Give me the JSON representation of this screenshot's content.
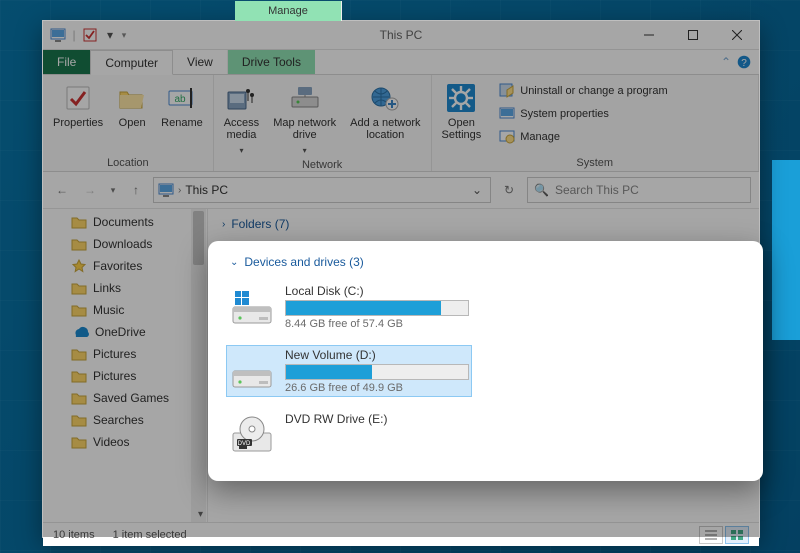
{
  "title": "This PC",
  "context_caption": "Manage",
  "tabs": {
    "file": "File",
    "computer": "Computer",
    "view": "View",
    "drivetools": "Drive Tools"
  },
  "ribbon": {
    "location": {
      "properties": "Properties",
      "open": "Open",
      "rename": "Rename",
      "caption": "Location"
    },
    "network": {
      "access": "Access\nmedia",
      "map": "Map network\ndrive",
      "add": "Add a network\nlocation",
      "caption": "Network"
    },
    "system": {
      "open": "Open\nSettings",
      "uninstall": "Uninstall or change a program",
      "sysprops": "System properties",
      "manage": "Manage",
      "caption": "System"
    }
  },
  "breadcrumb": "This PC",
  "search_placeholder": "Search This PC",
  "nav_items": [
    "Documents",
    "Downloads",
    "Favorites",
    "Links",
    "Music",
    "OneDrive",
    "Pictures",
    "Pictures",
    "Saved Games",
    "Searches",
    "Videos"
  ],
  "folders_header": "Folders (7)",
  "devices_header": "Devices and drives (3)",
  "drives": [
    {
      "name": "Local Disk (C:)",
      "free": "8.44 GB free of 57.4 GB",
      "fill_pct": 85,
      "type": "hdd-win",
      "selected": false
    },
    {
      "name": "New Volume (D:)",
      "free": "26.6 GB free of 49.9 GB",
      "fill_pct": 47,
      "type": "hdd",
      "selected": true
    },
    {
      "name": "DVD RW Drive (E:)",
      "free": "",
      "fill_pct": 0,
      "type": "dvd",
      "selected": false
    }
  ],
  "status": {
    "items": "10 items",
    "selected": "1 item selected"
  }
}
